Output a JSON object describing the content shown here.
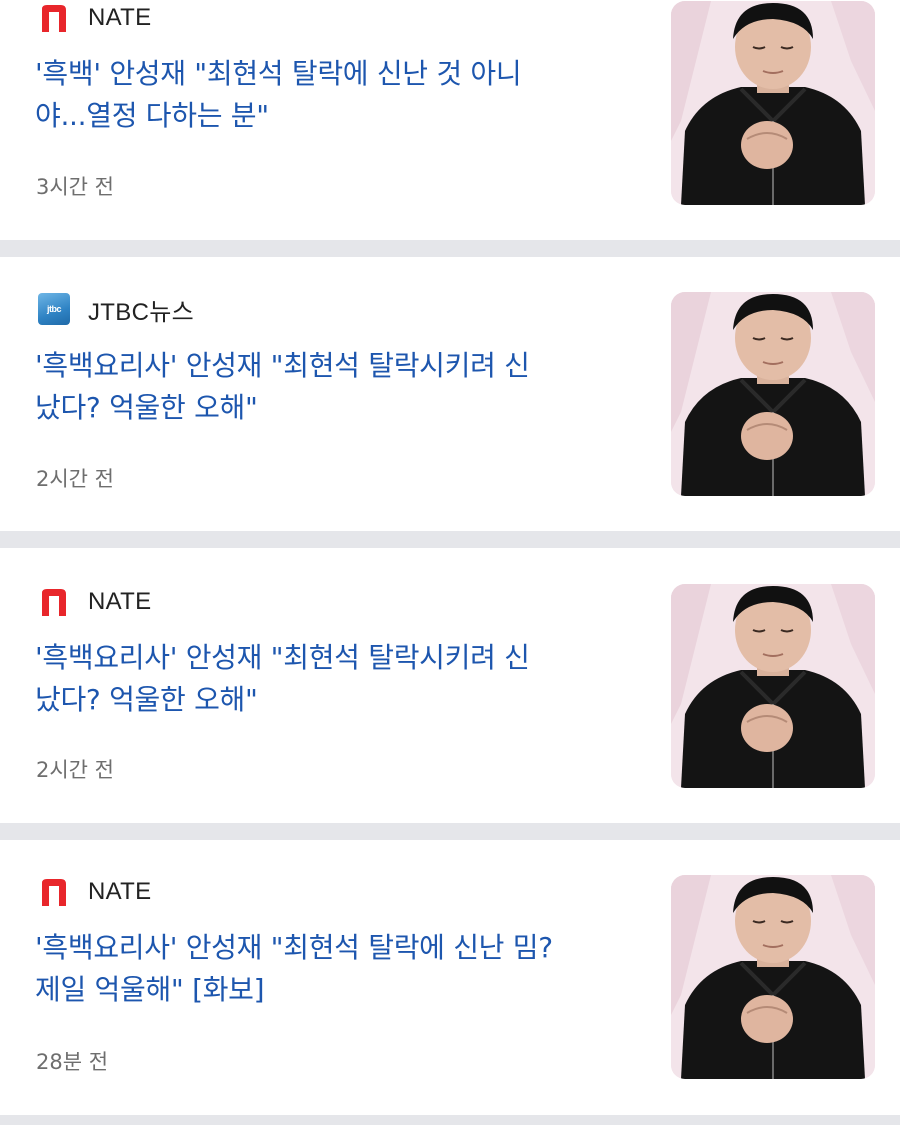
{
  "articles": [
    {
      "source": "NATE",
      "source_logo": "nate-logo",
      "headline_line1": "'흑백' 안성재 \"최현석 탈락에 신난 것 아니",
      "headline_line2": "야...열정 다하는 분\"",
      "time": "3시간 전"
    },
    {
      "source": "JTBC뉴스",
      "source_logo": "jtbc-logo",
      "headline_line1": "'흑백요리사' 안성재 \"최현석 탈락시키려 신",
      "headline_line2": "났다? 억울한 오해\"",
      "time": "2시간 전"
    },
    {
      "source": "NATE",
      "source_logo": "nate-logo",
      "headline_line1": "'흑백요리사' 안성재 \"최현석 탈락시키려 신",
      "headline_line2": "났다? 억울한 오해\"",
      "time": "2시간 전"
    },
    {
      "source": "NATE",
      "source_logo": "nate-logo",
      "headline_line1": "'흑백요리사' 안성재 \"최현석 탈락에 신난 밈?",
      "headline_line2": "제일 억울해\" [화보]",
      "time": "28분 전"
    }
  ],
  "colors": {
    "headline": "#1d56ae",
    "source_text": "#222222",
    "time_text": "#6e6e6e",
    "nate_red": "#e8262b",
    "separator": "#e5e6ea",
    "thumbnail_bg": "#f3e4ea"
  }
}
